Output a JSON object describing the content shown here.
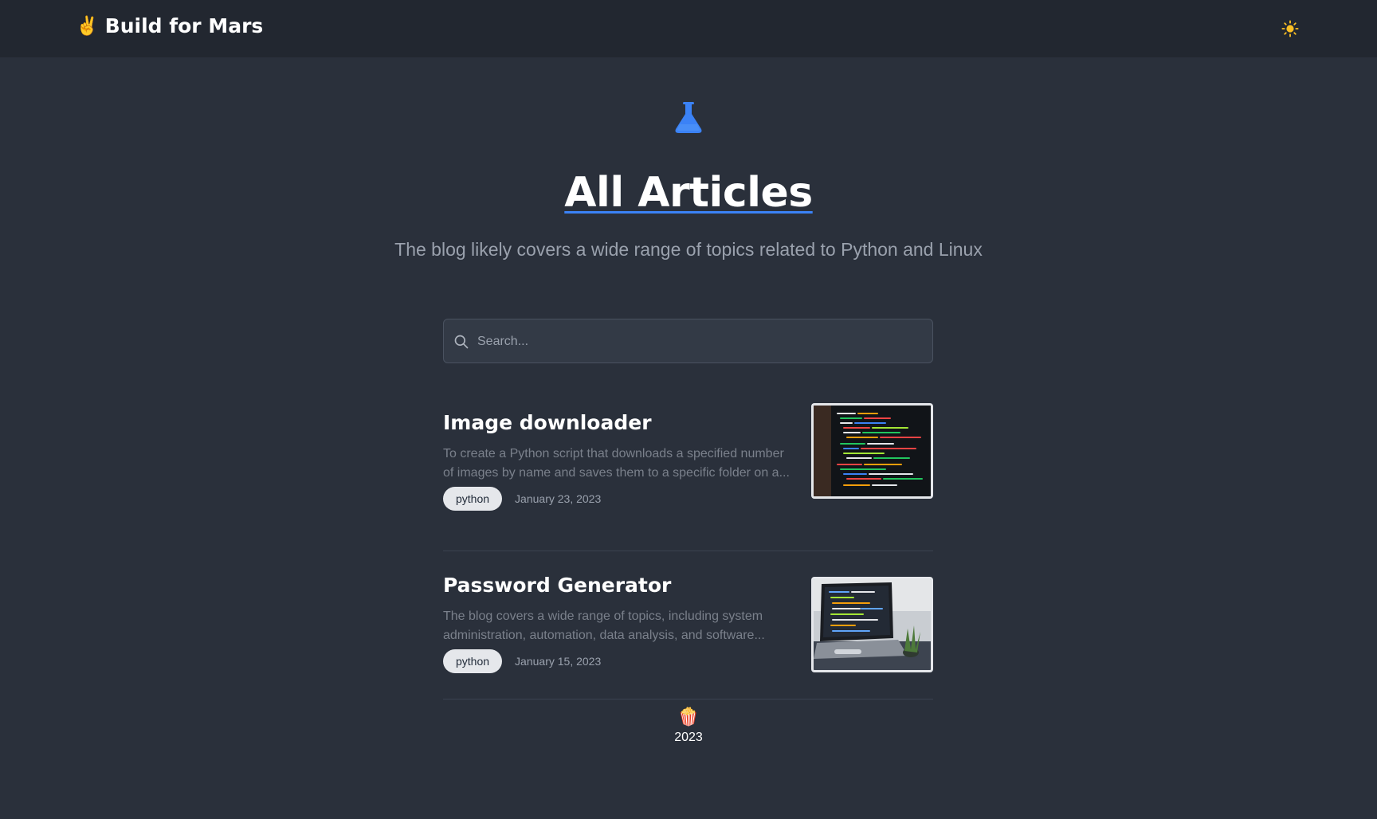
{
  "header": {
    "brand_emoji": "✌️",
    "brand_name": "Build for Mars",
    "theme_toggle_icon": "sun-icon"
  },
  "hero": {
    "icon": "flask-icon",
    "title": "All Articles",
    "subtitle": "The blog likely covers a wide range of topics related to Python and Linux"
  },
  "search": {
    "placeholder": "Search...",
    "value": ""
  },
  "articles": [
    {
      "title": "Image downloader",
      "excerpt": "To create a Python script that downloads a specified number of images by name and saves them to a specific folder on a...",
      "tag": "python",
      "date": "January 23, 2023",
      "thumbnail": "code-screen-image"
    },
    {
      "title": "Password Generator",
      "excerpt": "The blog covers a wide range of topics, including system administration, automation, data analysis, and software...",
      "tag": "python",
      "date": "January 15, 2023",
      "thumbnail": "laptop-code-image"
    }
  ],
  "footer": {
    "emoji": "🍿",
    "year": "2023"
  },
  "colors": {
    "accent": "#3b82f6",
    "background": "#2a303b",
    "header_bg": "#222730"
  }
}
